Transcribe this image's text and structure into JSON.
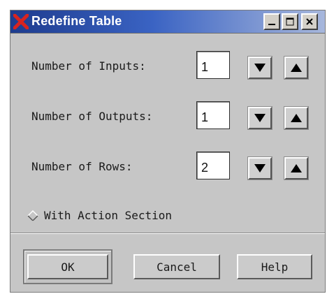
{
  "window": {
    "title": "Redefine Table",
    "controls": [
      "minimize",
      "maximize",
      "close"
    ]
  },
  "fields": [
    {
      "label": "Number of Inputs:",
      "value": "1"
    },
    {
      "label": "Number of Outputs:",
      "value": "1"
    },
    {
      "label": "Number of Rows:",
      "value": "2"
    }
  ],
  "option": {
    "label": "With Action Section",
    "checked": false
  },
  "buttons": {
    "ok": "OK",
    "cancel": "Cancel",
    "help": "Help"
  },
  "icons": {
    "app": "x-logo-icon",
    "decrement": "triangle-down-icon",
    "increment": "triangle-up-icon",
    "radio": "diamond-radio-icon"
  },
  "colors": {
    "title_bar_start": "#1e3c8e",
    "title_bar_end": "#a7b7dc",
    "dialog_bg": "#c6c6c6",
    "app_icon": "#d8231f"
  }
}
